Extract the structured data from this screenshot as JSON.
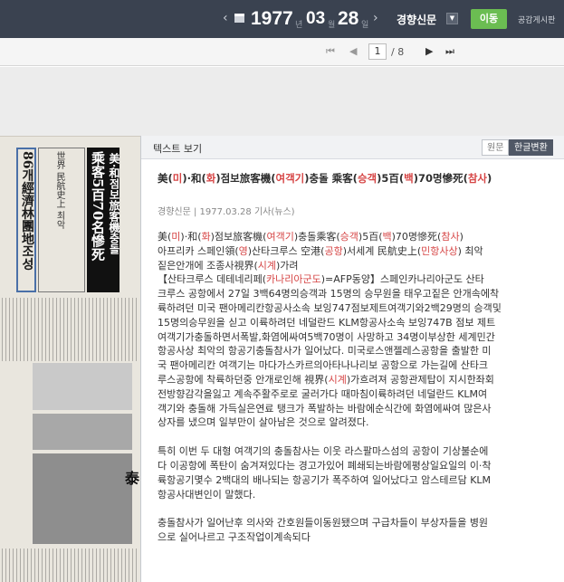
{
  "topbar": {
    "prev_arrow": "‹",
    "next_arrow": "›",
    "year": "1977",
    "year_unit": "년",
    "month": "03",
    "month_unit": "월",
    "day": "28",
    "day_unit": "일",
    "paper": "경향신문",
    "go_label": "이동",
    "board_label": "공감게시판"
  },
  "pager": {
    "first": "⏮",
    "prev": "◀",
    "current_page": "1",
    "total": "/ 8",
    "next": "▶",
    "last": "⏭"
  },
  "scan": {
    "col1": "86개經濟林團地조성",
    "col2": "美·和점보旅客機충돌",
    "col3": "乘客5百70名慘死",
    "col4": "世界 民航史上 최악",
    "photo_caption": "泰"
  },
  "panel": {
    "title": "텍스트 보기",
    "tab_original": "원문",
    "tab_korean": "한글변환",
    "headline": "美(미)·和(화)점보旅客機(여객기)충돌 乘客(승객)5百(백)70명慘死(참사)",
    "meta": "경향신문 | 1977.03.28 기사(뉴스)",
    "lines": [
      "美(미)·和(화)점보旅客機(여객기)충돌乘客(승객)5百(백)70명慘死(참사)",
      "아프리카 스페인領(영)산타크루스 空港(공항)서세계 民航史上(민항사상) 최악",
      "짙은안개에 조종사視界(시계)가려",
      "【산타크루스 데테네리페(카나리아군도)=AFP동양】스페인카나리아군도 산타",
      "크루스 공항에서 27일 3백64명의승객과 15명의 승무원을 태우고짙은 안개속에착",
      "륙하려던 미국 팬아메리칸항공사소속 보잉747점보제트여객기와2백29명의 승객및",
      "15명의승무원을 싣고 이륙하려던 네덜란드 KLM항공사소속 보잉747B 점보 제트",
      "여객기가충돌하면서폭발,화염에싸여5백70명이 사망하고 34명이부상한 세계민간",
      "항공사상 최악의 항공기충돌참사가 일어났다. 미국로스앤젤레스공항을 출발한 미",
      "국 팬아메리칸 여객기는 마다가스카르의아타나나리보 공항으로 가는길에 산타크",
      "루스공항에 착륙하던중 안개로인해 視界(시계)가흐려져 공항관제탑이 지시한좌회",
      "전방향감각을잃고 계속주활주로로 굴러가다 때마침이륙하려던 네덜란드 KLM여",
      "객기와 충돌해 가득실은연료 탱크가 폭발하는 바람에순식간에 화염에싸여 많은사",
      "상자를 냈으며 일부만이 살아남은 것으로 알려졌다.",
      "",
      "특히 이번 두 대형 여객기의 충돌참사는 이웃 라스팔마스섬의 공항이 기상불순에",
      "다 이공항에 폭탄이 숨겨져있다는 경고가있어 폐쇄되는바람에평상일요일의 이·착",
      "륙항공기몇수 2백대의 배나되는 항공기가 폭주하여 일어났다고 암스테르담 KLM",
      "항공사대변인이 말했다.",
      "",
      "충돌참사가 일어난후 의사와 간호원들이동원됐으며 구급차들이 부상자들을 병원",
      "으로 실어나르고 구조작업이계속되다"
    ]
  }
}
